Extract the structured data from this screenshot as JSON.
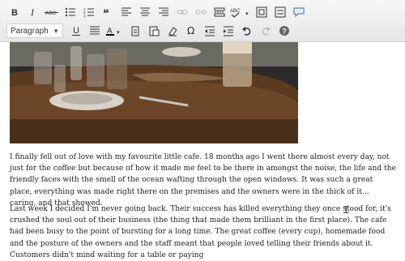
{
  "toolbar": {
    "row1": [
      {
        "icon": "bold-icon",
        "glyph": "B"
      },
      {
        "icon": "italic-icon",
        "glyph": "I"
      },
      {
        "icon": "strikethrough-icon",
        "glyph": "ABC"
      },
      {
        "icon": "bullet-list-icon",
        "glyph": "list"
      },
      {
        "icon": "numbered-list-icon",
        "glyph": "numlist"
      },
      {
        "icon": "blockquote-icon",
        "glyph": "❝"
      },
      {
        "icon": "align-left-icon",
        "glyph": "alignL"
      },
      {
        "icon": "align-center-icon",
        "glyph": "alignC"
      },
      {
        "icon": "align-right-icon",
        "glyph": "alignR"
      },
      {
        "icon": "insert-link-icon",
        "glyph": "link"
      },
      {
        "icon": "unlink-icon",
        "glyph": "unlink"
      },
      {
        "icon": "insert-more-icon",
        "glyph": "more"
      },
      {
        "icon": "spellcheck-icon",
        "glyph": "ABC✓"
      },
      {
        "icon": "fullscreen-icon",
        "glyph": "full"
      },
      {
        "icon": "toolbar-toggle-icon",
        "glyph": "kitchen"
      },
      {
        "icon": "speech-bubble-icon",
        "glyph": "bubble"
      }
    ],
    "format": {
      "selected": "Paragraph"
    },
    "row2": [
      {
        "icon": "underline-icon",
        "glyph": "U"
      },
      {
        "icon": "justify-icon",
        "glyph": "justify"
      },
      {
        "icon": "text-color-icon",
        "glyph": "A"
      },
      {
        "icon": "paste-as-text-icon",
        "glyph": "paste"
      },
      {
        "icon": "paste-from-word-icon",
        "glyph": "pasteword"
      },
      {
        "icon": "clear-formatting-icon",
        "glyph": "eraser"
      },
      {
        "icon": "special-character-icon",
        "glyph": "Ω"
      },
      {
        "icon": "outdent-icon",
        "glyph": "outdent"
      },
      {
        "icon": "indent-icon",
        "glyph": "indent"
      },
      {
        "icon": "undo-icon",
        "glyph": "undo"
      },
      {
        "icon": "redo-icon",
        "glyph": "redo"
      },
      {
        "icon": "help-icon",
        "glyph": "?"
      }
    ]
  },
  "content": {
    "p1": "I finally fell out of love with my favourite little cafe. 18 months ago I went there almost every day, not just for the coffee but because of how it made me feel to be there in amongst the noise, the life and the friendly faces with the smell of the ocean wafting through the open windows. It was such a great place, everything was made right there on the premises and the owners were in the thick of it... caring, and that showed.",
    "p2": "Last week I decided I'm never going back. Their success has killed everything they once stood for, it's crushed the soul out of their business (the thing that made them brilliant in the first place). The cafe had been busy to the point of bursting for a long time. The great coffee (every cup), homemade food and the posture of the owners and the staff meant that people loved telling their friends about it. Customers didn't mind waiting for a table or paying"
  }
}
